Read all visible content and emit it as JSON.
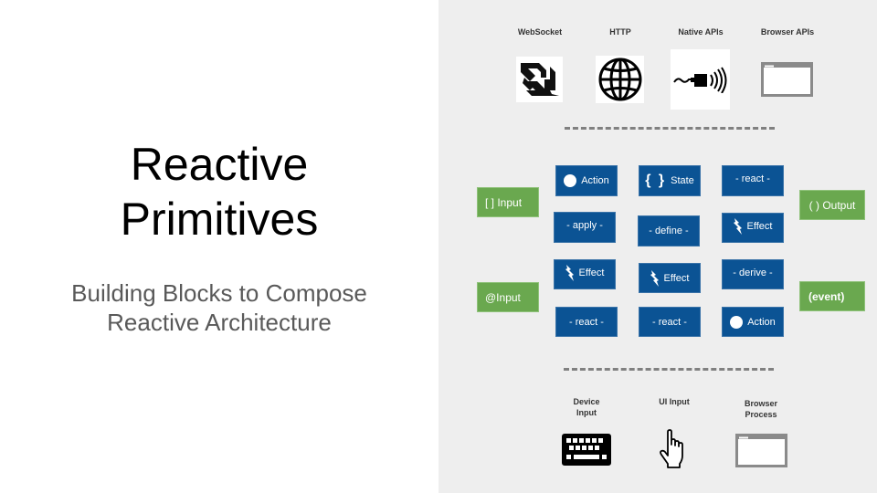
{
  "slide": {
    "title_line1": "Reactive",
    "title_line2": "Primitives",
    "subtitle_line1": "Building Blocks to Compose",
    "subtitle_line2": "Reactive Architecture"
  },
  "top_sources": [
    {
      "label": "WebSocket",
      "icon": "websocket-icon"
    },
    {
      "label": "HTTP",
      "icon": "globe-icon"
    },
    {
      "label": "Native APIs",
      "icon": "speaker-plug-icon"
    },
    {
      "label": "Browser APIs",
      "icon": "browser-window-icon"
    }
  ],
  "bottom_sources": [
    {
      "label_line1": "Device",
      "label_line2": "Input",
      "icon": "keyboard-icon"
    },
    {
      "label_line1": "UI Input",
      "label_line2": "",
      "icon": "hand-pointer-icon"
    },
    {
      "label_line1": "Browser",
      "label_line2": "Process",
      "icon": "browser-window-icon"
    }
  ],
  "inputs": [
    {
      "label": "[ ] Input",
      "bold": false
    },
    {
      "label": "@Input",
      "bold": false
    }
  ],
  "outputs": [
    {
      "label": "( ) Output",
      "bold": false
    },
    {
      "label": "(event)",
      "bold": true
    }
  ],
  "primitives": [
    {
      "label": "Action",
      "icon": "circle-icon"
    },
    {
      "label": "State",
      "icon": "braces-icon",
      "icon_text": "{ }"
    },
    {
      "label": "- react -",
      "icon": ""
    },
    {
      "label": "- apply -",
      "icon": ""
    },
    {
      "label": "- define -",
      "icon": ""
    },
    {
      "label": "Effect",
      "icon": "lightning-icon"
    },
    {
      "label": "Effect",
      "icon": "lightning-icon"
    },
    {
      "label": "Effect",
      "icon": "lightning-icon"
    },
    {
      "label": "- derive -",
      "icon": ""
    },
    {
      "label": "- react -",
      "icon": ""
    },
    {
      "label": "- react -",
      "icon": ""
    },
    {
      "label": "Action",
      "icon": "circle-icon"
    }
  ],
  "colors": {
    "primitive_blue": "#0b5394",
    "io_green": "#6aa84f",
    "panel_gray": "#eeeeee"
  }
}
